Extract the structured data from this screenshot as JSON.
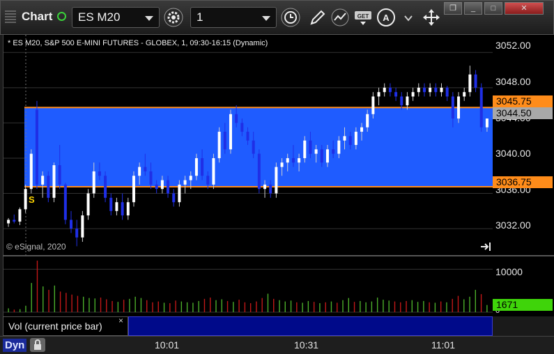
{
  "toolbar": {
    "app_title": "Chart",
    "symbol": "ES M20",
    "interval": "1",
    "buttons": [
      "settings-icon",
      "clock-icon",
      "draw-pencil-icon",
      "study-icon",
      "get-data-icon",
      "alert-icon",
      "cursor-icon"
    ],
    "get_label": "GET",
    "alert_label": "A"
  },
  "window_controls": {
    "restore_label": "❐",
    "min_label": "_",
    "max_label": "□",
    "close_label": "✕"
  },
  "chart_header": "* ES M20, S&P 500 E-MINI FUTURES - GLOBEX, 1, 09:30-16:15 (Dynamic)",
  "copyright": "© eSignal, 2020",
  "signal_label": "S",
  "price_axis": {
    "ticks": [
      "3052.00",
      "3048.00",
      "3044.00",
      "3040.00",
      "3036.00",
      "3032.00"
    ],
    "tags": {
      "upper_line": "3045.75",
      "last_price": "3044.50",
      "lower_line": "3036.75"
    }
  },
  "volume_axis": {
    "ticks": [
      "10000",
      "0"
    ],
    "current": "1671"
  },
  "volume_label": "Vol (current price bar)",
  "volume_close": "×",
  "time_axis": [
    "10:01",
    "10:31",
    "11:01"
  ],
  "status": {
    "mode": "Dyn"
  },
  "colors": {
    "up_bar": "#ffffff",
    "down_bar": "#1f2fe6",
    "band_fill": "#1f5cff",
    "band_line": "#ff8c1a",
    "vol_up": "#4caf2a",
    "vol_down": "#c21818"
  },
  "chart_data": {
    "type": "candlestick",
    "ylim": [
      3029.0,
      3054.0
    ],
    "band": {
      "upper": 3045.75,
      "lower": 3036.75
    },
    "ohlc": [
      [
        3032.6,
        3033.2,
        3032.2,
        3033.0
      ],
      [
        3033.0,
        3033.6,
        3032.6,
        3032.8
      ],
      [
        3032.8,
        3034.4,
        3032.4,
        3034.2
      ],
      [
        3034.2,
        3037.0,
        3033.8,
        3036.5
      ],
      [
        3036.5,
        3041.0,
        3036.0,
        3040.5
      ],
      [
        3045.5,
        3046.5,
        3036.5,
        3037.0
      ],
      [
        3037.0,
        3038.5,
        3035.5,
        3038.0
      ],
      [
        3038.0,
        3038.5,
        3035.0,
        3035.5
      ],
      [
        3035.5,
        3039.5,
        3035.0,
        3039.2
      ],
      [
        3039.2,
        3041.5,
        3036.5,
        3037.0
      ],
      [
        3037.0,
        3037.2,
        3032.5,
        3033.0
      ],
      [
        3033.0,
        3034.0,
        3031.5,
        3032.0
      ],
      [
        3032.0,
        3033.0,
        3030.0,
        3031.0
      ],
      [
        3031.0,
        3034.0,
        3030.5,
        3033.5
      ],
      [
        3033.5,
        3036.5,
        3033.0,
        3036.0
      ],
      [
        3036.0,
        3039.5,
        3035.5,
        3038.5
      ],
      [
        3038.5,
        3039.5,
        3037.5,
        3038.0
      ],
      [
        3038.0,
        3038.5,
        3035.0,
        3035.5
      ],
      [
        3035.5,
        3036.0,
        3033.5,
        3034.0
      ],
      [
        3034.0,
        3035.5,
        3033.5,
        3035.0
      ],
      [
        3035.0,
        3036.0,
        3033.0,
        3033.5
      ],
      [
        3033.5,
        3035.5,
        3033.0,
        3035.0
      ],
      [
        3035.0,
        3038.5,
        3034.5,
        3038.0
      ],
      [
        3038.0,
        3039.5,
        3037.0,
        3039.0
      ],
      [
        3039.0,
        3040.5,
        3038.0,
        3038.5
      ],
      [
        3038.5,
        3039.5,
        3036.5,
        3037.0
      ],
      [
        3037.0,
        3037.5,
        3036.0,
        3036.5
      ],
      [
        3036.5,
        3038.0,
        3036.0,
        3037.5
      ],
      [
        3037.5,
        3038.0,
        3035.5,
        3036.0
      ],
      [
        3036.0,
        3036.5,
        3034.5,
        3035.0
      ],
      [
        3035.0,
        3037.5,
        3034.5,
        3037.0
      ],
      [
        3037.0,
        3038.0,
        3036.0,
        3037.5
      ],
      [
        3037.5,
        3038.5,
        3036.5,
        3038.0
      ],
      [
        3038.0,
        3040.5,
        3037.5,
        3040.0
      ],
      [
        3040.0,
        3041.0,
        3037.5,
        3038.0
      ],
      [
        3038.0,
        3038.5,
        3036.5,
        3037.0
      ],
      [
        3037.0,
        3040.5,
        3036.5,
        3040.0
      ],
      [
        3040.0,
        3043.5,
        3039.5,
        3043.0
      ],
      [
        3043.0,
        3044.0,
        3040.5,
        3041.0
      ],
      [
        3041.0,
        3045.5,
        3040.5,
        3045.0
      ],
      [
        3045.0,
        3046.0,
        3043.5,
        3044.0
      ],
      [
        3044.0,
        3044.5,
        3042.5,
        3043.0
      ],
      [
        3043.0,
        3043.5,
        3041.5,
        3042.0
      ],
      [
        3042.0,
        3043.0,
        3040.0,
        3040.5
      ],
      [
        3040.5,
        3041.0,
        3036.0,
        3036.5
      ],
      [
        3036.5,
        3037.5,
        3035.5,
        3037.0
      ],
      [
        3037.0,
        3037.5,
        3035.5,
        3036.0
      ],
      [
        3036.0,
        3039.5,
        3035.5,
        3039.0
      ],
      [
        3039.0,
        3040.0,
        3038.0,
        3039.5
      ],
      [
        3039.5,
        3040.5,
        3038.5,
        3040.0
      ],
      [
        3040.0,
        3041.5,
        3039.0,
        3039.5
      ],
      [
        3039.5,
        3040.5,
        3038.5,
        3040.0
      ],
      [
        3040.0,
        3042.5,
        3039.5,
        3042.0
      ],
      [
        3042.0,
        3043.0,
        3040.0,
        3040.5
      ],
      [
        3040.5,
        3041.5,
        3039.5,
        3041.0
      ],
      [
        3041.0,
        3041.5,
        3039.0,
        3039.5
      ],
      [
        3039.5,
        3041.5,
        3039.0,
        3041.0
      ],
      [
        3041.0,
        3042.0,
        3040.0,
        3040.5
      ],
      [
        3040.5,
        3042.5,
        3040.0,
        3042.0
      ],
      [
        3042.0,
        3043.5,
        3041.0,
        3042.5
      ],
      [
        3042.5,
        3043.0,
        3041.0,
        3041.5
      ],
      [
        3041.5,
        3043.5,
        3041.0,
        3043.0
      ],
      [
        3043.0,
        3044.0,
        3042.0,
        3043.5
      ],
      [
        3043.5,
        3045.5,
        3043.0,
        3045.0
      ],
      [
        3045.0,
        3047.5,
        3044.5,
        3047.0
      ],
      [
        3047.0,
        3048.0,
        3046.0,
        3047.5
      ],
      [
        3047.5,
        3048.5,
        3047.0,
        3048.0
      ],
      [
        3048.0,
        3048.5,
        3047.0,
        3047.5
      ],
      [
        3047.5,
        3048.0,
        3046.5,
        3047.0
      ],
      [
        3047.0,
        3047.5,
        3045.5,
        3046.0
      ],
      [
        3046.0,
        3047.5,
        3045.5,
        3047.0
      ],
      [
        3047.0,
        3048.0,
        3046.5,
        3047.5
      ],
      [
        3047.5,
        3048.5,
        3047.0,
        3048.0
      ],
      [
        3048.0,
        3048.5,
        3047.0,
        3047.5
      ],
      [
        3047.5,
        3048.5,
        3047.0,
        3048.0
      ],
      [
        3048.0,
        3048.5,
        3047.0,
        3047.5
      ],
      [
        3047.5,
        3048.5,
        3047.0,
        3048.0
      ],
      [
        3048.0,
        3048.2,
        3046.5,
        3047.0
      ],
      [
        3047.0,
        3047.5,
        3043.5,
        3044.5
      ],
      [
        3044.5,
        3047.5,
        3044.0,
        3047.0
      ],
      [
        3047.0,
        3048.0,
        3046.5,
        3047.5
      ],
      [
        3047.5,
        3050.5,
        3047.0,
        3049.5
      ],
      [
        3049.5,
        3050.0,
        3047.5,
        3048.0
      ],
      [
        3048.0,
        3048.5,
        3043.0,
        3043.5
      ],
      [
        3043.5,
        3044.5,
        3043.0,
        3044.5
      ]
    ],
    "volume_max": 12000,
    "volume": [
      900,
      600,
      700,
      1500,
      6800,
      12000,
      6000,
      5200,
      6200,
      4800,
      4500,
      4100,
      3800,
      3600,
      3300,
      3200,
      3400,
      3000,
      2600,
      2400,
      2900,
      3100,
      3600,
      3300,
      2800,
      2300,
      2500,
      2200,
      2100,
      2700,
      2500,
      2300,
      2200,
      2600,
      3100,
      3400,
      2800,
      3000,
      2600,
      2400,
      2900,
      2300,
      2100,
      2500,
      3300,
      4300,
      3100,
      2800,
      2500,
      2700,
      2300,
      2200,
      2600,
      2400,
      2100,
      2300,
      2500,
      2200,
      2800,
      3300,
      2400,
      2600,
      2300,
      2500,
      3400,
      2900,
      2700,
      2500,
      2300,
      2600,
      2800,
      2400,
      2600,
      2300,
      2200,
      2500,
      2300,
      3100,
      3800,
      3000,
      3600,
      5200,
      4200,
      1671
    ],
    "volume_up": [
      true,
      false,
      true,
      true,
      true,
      false,
      true,
      false,
      true,
      false,
      false,
      false,
      false,
      true,
      true,
      true,
      false,
      false,
      false,
      true,
      false,
      true,
      true,
      true,
      false,
      false,
      false,
      true,
      false,
      false,
      true,
      true,
      true,
      true,
      false,
      false,
      true,
      true,
      false,
      true,
      false,
      false,
      false,
      false,
      false,
      true,
      false,
      true,
      true,
      true,
      false,
      true,
      true,
      false,
      true,
      false,
      true,
      false,
      true,
      true,
      false,
      true,
      true,
      true,
      true,
      true,
      true,
      false,
      false,
      false,
      true,
      true,
      true,
      false,
      true,
      false,
      true,
      false,
      false,
      true,
      true,
      true,
      false,
      true
    ]
  }
}
